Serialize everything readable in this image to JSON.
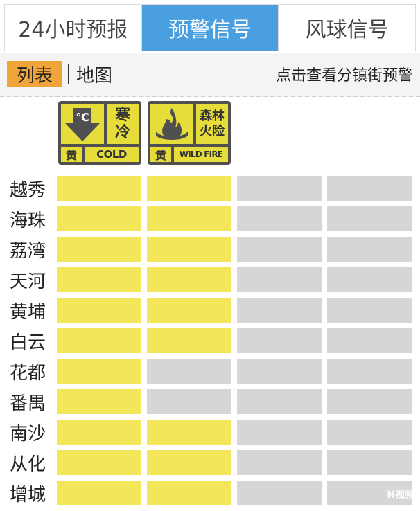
{
  "tabs": [
    {
      "label": "24小时预报",
      "active": false
    },
    {
      "label": "预警信号",
      "active": true
    },
    {
      "label": "风球信号",
      "active": false
    }
  ],
  "view_toggle": {
    "list": "列表",
    "map": "地图",
    "selected": "list"
  },
  "hint": "点击查看分镇街预警",
  "warnings": [
    {
      "icon": "cold-wave-warning-icon",
      "symbol": "℃",
      "title_line1": "寒",
      "title_line2": "冷",
      "level": "黄",
      "code": "COLD",
      "color": "#e7dd3a"
    },
    {
      "icon": "forest-fire-warning-icon",
      "symbol": "",
      "title_line1": "森林",
      "title_line2": "火险",
      "level": "黄",
      "code": "WILD FIRE",
      "color": "#e7dd3a"
    }
  ],
  "colors": {
    "active_tab": "#4a9fe0",
    "selected_view": "#f0a53a",
    "warning_on": "#f3e65a",
    "no_warning": "#d6d6d6"
  },
  "districts": [
    {
      "name": "越秀",
      "cells": [
        true,
        true,
        false,
        false
      ]
    },
    {
      "name": "海珠",
      "cells": [
        true,
        true,
        false,
        false
      ]
    },
    {
      "name": "荔湾",
      "cells": [
        true,
        true,
        false,
        false
      ]
    },
    {
      "name": "天河",
      "cells": [
        true,
        true,
        false,
        false
      ]
    },
    {
      "name": "黄埔",
      "cells": [
        true,
        true,
        false,
        false
      ]
    },
    {
      "name": "白云",
      "cells": [
        true,
        true,
        false,
        false
      ]
    },
    {
      "name": "花都",
      "cells": [
        true,
        false,
        false,
        false
      ]
    },
    {
      "name": "番禺",
      "cells": [
        true,
        false,
        false,
        false
      ]
    },
    {
      "name": "南沙",
      "cells": [
        true,
        true,
        false,
        false
      ]
    },
    {
      "name": "从化",
      "cells": [
        true,
        true,
        false,
        false
      ]
    },
    {
      "name": "增城",
      "cells": [
        true,
        true,
        false,
        false
      ]
    }
  ],
  "watermark": {
    "brand": "N视频"
  }
}
